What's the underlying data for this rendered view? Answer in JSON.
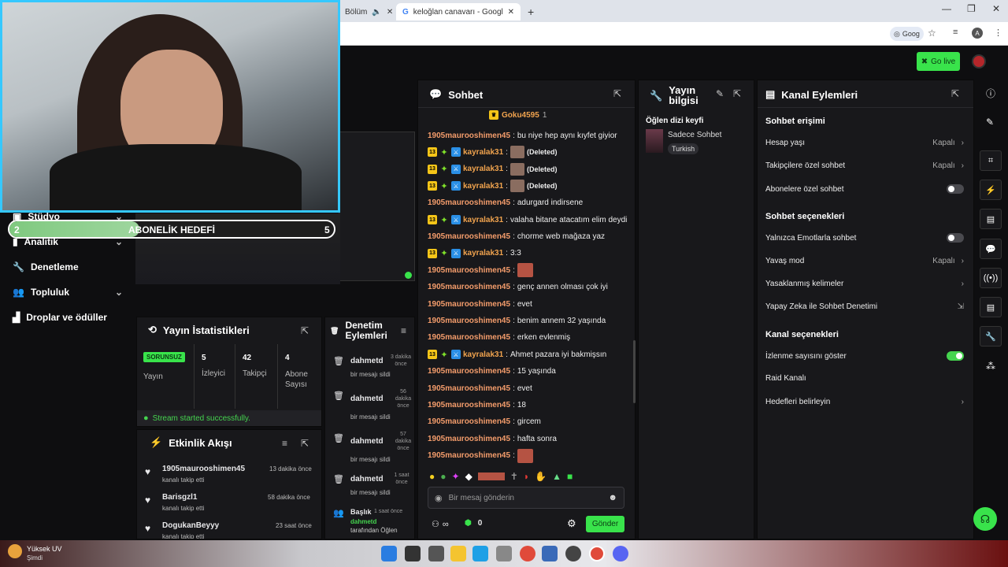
{
  "browser": {
    "tabs": [
      "Bölüm",
      "keloğlan canavarı - Google Sea"
    ],
    "new_tab": "+",
    "address_chip": "Goog",
    "profile_letter": "A"
  },
  "header": {
    "go_live": "Go live"
  },
  "left_nav": {
    "items": [
      {
        "label": "Stüdyo",
        "chev": true
      },
      {
        "label": "Analitik",
        "chev": true
      },
      {
        "label": "Denetleme",
        "chev": false
      },
      {
        "label": "Topluluk",
        "chev": true
      },
      {
        "label": "Droplar ve ödüller",
        "chev": false
      }
    ]
  },
  "goal": {
    "current": "2",
    "label": "ABONELİK HEDEFİ",
    "target": "5",
    "progress": 0.4
  },
  "stats": {
    "title": "Yayın İstatistikleri",
    "status_badge": "SORUNSUZ",
    "cols": [
      {
        "label": "Yayın",
        "value": ""
      },
      {
        "label": "İzleyici",
        "value": "5"
      },
      {
        "label": "Takipçi",
        "value": "42"
      },
      {
        "label": "Abone Sayısı",
        "value": "4"
      }
    ],
    "success": "Stream started successfully."
  },
  "activity": {
    "title": "Etkinlik Akışı",
    "items": [
      {
        "user": "1905maurooshimen45",
        "action": "kanalı takip etti",
        "time": "13 dakika önce"
      },
      {
        "user": "Barisgzl1",
        "action": "kanalı takip etti",
        "time": "58 dakika önce"
      },
      {
        "user": "DogukanBeyyy",
        "action": "kanalı takip etti",
        "time": "23 saat önce"
      }
    ]
  },
  "mod_actions": {
    "title": "Denetim Eylemleri",
    "items": [
      {
        "user": "dahmetd",
        "action": "bir mesajı sildi",
        "time": "3 dakika önce"
      },
      {
        "user": "dahmetd",
        "action": "bir mesajı sildi",
        "time": "56 dakika önce"
      },
      {
        "user": "dahmetd",
        "action": "bir mesajı sildi",
        "time": "57 dakika önce"
      },
      {
        "user": "dahmetd",
        "action": "bir mesajı sildi",
        "time": "1 saat önce"
      }
    ],
    "last": {
      "title": "Başlık",
      "time": "1 saat önce",
      "user": "dahmetd",
      "text": "tarafından Öğlen"
    }
  },
  "chat": {
    "title": "Sohbet",
    "pinned_user": "Goku4595",
    "pinned_count": "1",
    "messages": [
      {
        "user": "1905maurooshimen45",
        "text": "bu niye hep aynı kıyfet giyior",
        "badges": false,
        "thumb": false
      },
      {
        "user": "kayralak31",
        "text": "(Deleted)",
        "badges": true,
        "thumb": true
      },
      {
        "user": "kayralak31",
        "text": "(Deleted)",
        "badges": true,
        "thumb": true
      },
      {
        "user": "kayralak31",
        "text": "(Deleted)",
        "badges": true,
        "thumb": true
      },
      {
        "user": "1905maurooshimen45",
        "text": "adurgard indirsene",
        "badges": false,
        "thumb": false
      },
      {
        "user": "kayralak31",
        "text": "valaha bitane atacatım elim deydi",
        "badges": true,
        "thumb": false
      },
      {
        "user": "1905maurooshimen45",
        "text": "chorme web mağaza yaz",
        "badges": false,
        "thumb": false
      },
      {
        "user": "kayralak31",
        "text": "3:3",
        "badges": true,
        "thumb": false
      },
      {
        "user": "1905maurooshimen45",
        "text": "",
        "badges": false,
        "thumb": true
      },
      {
        "user": "1905maurooshimen45",
        "text": "genç annen olması çok iyi",
        "badges": false,
        "thumb": false
      },
      {
        "user": "1905maurooshimen45",
        "text": "evet",
        "badges": false,
        "thumb": false
      },
      {
        "user": "1905maurooshimen45",
        "text": "benim annem 32 yaşında",
        "badges": false,
        "thumb": false
      },
      {
        "user": "1905maurooshimen45",
        "text": "erken evlenmiş",
        "badges": false,
        "thumb": false
      },
      {
        "user": "kayralak31",
        "text": "Ahmet pazara iyi bakmişsın",
        "badges": true,
        "thumb": false
      },
      {
        "user": "1905maurooshimen45",
        "text": "15 yaşında",
        "badges": false,
        "thumb": false
      },
      {
        "user": "1905maurooshimen45",
        "text": "evet",
        "badges": false,
        "thumb": false
      },
      {
        "user": "1905maurooshimen45",
        "text": "18",
        "badges": false,
        "thumb": false
      },
      {
        "user": "1905maurooshimen45",
        "text": "gircem",
        "badges": false,
        "thumb": false
      },
      {
        "user": "1905maurooshimen45",
        "text": "hafta sonra",
        "badges": false,
        "thumb": false
      },
      {
        "user": "1905maurooshimen45",
        "text": "",
        "badges": false,
        "thumb": true
      }
    ],
    "badge_level": "13",
    "input_placeholder": "Bir mesaj gönderin",
    "points": "0",
    "send": "Gönder"
  },
  "stream_info": {
    "title": "Yayın bilgisi",
    "stream_title": "Öğlen dizi keyfi",
    "category": "Sadece Sohbet",
    "tag": "Turkish"
  },
  "channel_actions": {
    "title": "Kanal Eylemleri",
    "sections": [
      {
        "heading": "Sohbet erişimi",
        "rows": [
          {
            "label": "Hesap yaşı",
            "value": "Kapalı",
            "kind": "chev"
          },
          {
            "label": "Takipçilere özel sohbet",
            "value": "Kapalı",
            "kind": "chev"
          },
          {
            "label": "Abonelere özel sohbet",
            "value": "",
            "kind": "toggle-off"
          }
        ]
      },
      {
        "heading": "Sohbet seçenekleri",
        "rows": [
          {
            "label": "Yalnızca Emotlarla sohbet",
            "value": "",
            "kind": "toggle-off"
          },
          {
            "label": "Yavaş mod",
            "value": "Kapalı",
            "kind": "chev"
          },
          {
            "label": "Yasaklanmış kelimeler",
            "value": "",
            "kind": "chev"
          },
          {
            "label": "Yapay Zeka ile Sohbet Denetimi",
            "value": "",
            "kind": "ext"
          }
        ]
      },
      {
        "heading": "Kanal seçenekleri",
        "rows": [
          {
            "label": "İzlenme sayısını göster",
            "value": "",
            "kind": "toggle-on"
          },
          {
            "label": "Raid Kanalı",
            "value": "",
            "kind": "none"
          },
          {
            "label": "Hedefleri belirleyin",
            "value": "",
            "kind": "chev"
          }
        ]
      }
    ]
  },
  "taskbar": {
    "weather_title": "Yüksek UV",
    "weather_sub": "Şimdi"
  }
}
